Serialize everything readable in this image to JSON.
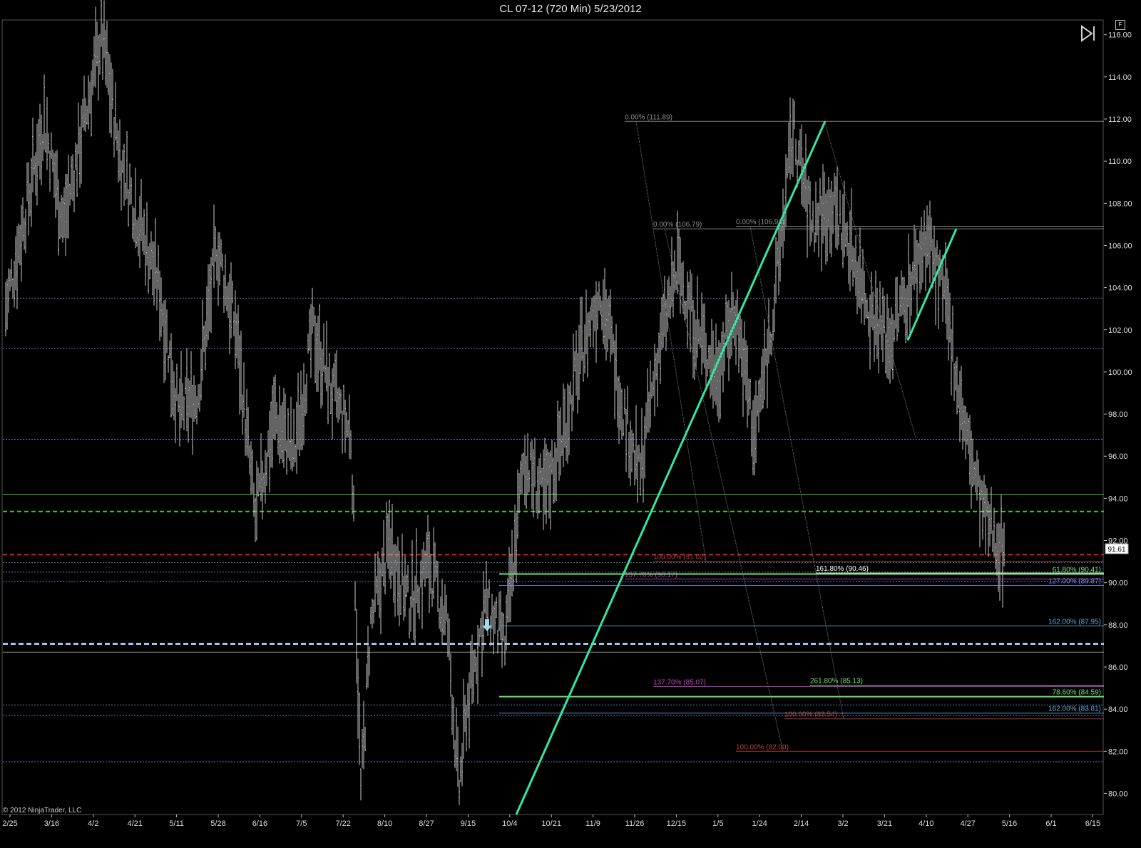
{
  "window": {
    "title": "CL 07-12 (720 Min)  5/23/2012"
  },
  "footer": {
    "copyright": "© 2012 NinjaTrader, LLC"
  },
  "controls": {
    "f_label": "F"
  },
  "colors": {
    "background": "#000000",
    "bars": "#c8c8c8",
    "trendline": "#33e6a0",
    "hline_blue_dash": "#6e86b4",
    "hline_green": "#4fcf4f",
    "hline_red": "#e02020",
    "current_price_box": "#ffffff"
  },
  "chart_data": {
    "type": "ohlc",
    "instrument": "CL 07-12",
    "interval": "720 Min",
    "date": "5/23/2012",
    "ylim": [
      79,
      116.7
    ],
    "y_ticks": [
      "116.00",
      "114.00",
      "112.00",
      "110.00",
      "108.00",
      "106.00",
      "104.00",
      "102.00",
      "100.00",
      "98.00",
      "96.00",
      "94.00",
      "92.00",
      "90.00",
      "88.00",
      "86.00",
      "84.00",
      "82.00",
      "80.00"
    ],
    "x_ticks": [
      "2/25",
      "3/16",
      "4/2",
      "4/21",
      "5/11",
      "5/28",
      "6/16",
      "7/5",
      "7/22",
      "8/10",
      "8/27",
      "9/15",
      "10/4",
      "10/21",
      "11/9",
      "11/26",
      "12/15",
      "1/5",
      "1/24",
      "2/14",
      "3/2",
      "3/21",
      "4/10",
      "4/27",
      "5/16",
      "6/1",
      "6/15"
    ],
    "current_price": "91.61",
    "price_path": [
      [
        0,
        103.0
      ],
      [
        2,
        112.0
      ],
      [
        3,
        107.0
      ],
      [
        5,
        116.0
      ],
      [
        6,
        110.0
      ],
      [
        8,
        104.0
      ],
      [
        9,
        98.0
      ],
      [
        10,
        99.0
      ],
      [
        11,
        106.0
      ],
      [
        12,
        102.0
      ],
      [
        13,
        93.0
      ],
      [
        14,
        98.0
      ],
      [
        15,
        96.0
      ],
      [
        16,
        102.0
      ],
      [
        17,
        99.0
      ],
      [
        18,
        97.0
      ],
      [
        18.5,
        80.0
      ],
      [
        19,
        88.0
      ],
      [
        20,
        92.0
      ],
      [
        21,
        89.0
      ],
      [
        22,
        91.0
      ],
      [
        23,
        88.0
      ],
      [
        23.6,
        80.0
      ],
      [
        24,
        84.0
      ],
      [
        25,
        89.0
      ],
      [
        26,
        87.0
      ],
      [
        27,
        96.0
      ],
      [
        28,
        94.0
      ],
      [
        29,
        97.0
      ],
      [
        30,
        101.0
      ],
      [
        31,
        104.0
      ],
      [
        32,
        99.0
      ],
      [
        33,
        95.0
      ],
      [
        34,
        101.0
      ],
      [
        35,
        105.0
      ],
      [
        36,
        102.0
      ],
      [
        37,
        100.0
      ],
      [
        38,
        103.0
      ],
      [
        39,
        97.0
      ],
      [
        40,
        103.0
      ],
      [
        41,
        111.5
      ],
      [
        42,
        107.0
      ],
      [
        43,
        108.0
      ],
      [
        44,
        106.0
      ],
      [
        45,
        103.0
      ],
      [
        46,
        101.5
      ],
      [
        47,
        104.0
      ],
      [
        48,
        106.5
      ],
      [
        49,
        103.0
      ],
      [
        50,
        97.0
      ],
      [
        51,
        93.0
      ],
      [
        52,
        91.61
      ]
    ],
    "horizontal_lines": [
      {
        "y": 103.5,
        "style": "dotted",
        "color": "blue"
      },
      {
        "y": 101.1,
        "style": "dotted",
        "color": "blue"
      },
      {
        "y": 96.8,
        "style": "dotted",
        "color": "blue"
      },
      {
        "y": 94.2,
        "style": "solid-thin",
        "color": "green"
      },
      {
        "y": 93.38,
        "style": "dashed",
        "color": "green"
      },
      {
        "y": 91.33,
        "style": "dashed",
        "color": "red"
      },
      {
        "y": 90.95,
        "style": "dotted",
        "color": "blue"
      },
      {
        "y": 90.5,
        "style": "dotted",
        "color": "blue"
      },
      {
        "y": 90.05,
        "style": "dotted",
        "color": "blue"
      },
      {
        "y": 87.1,
        "style": "dashed-thick",
        "color": "lightblue"
      },
      {
        "y": 86.7,
        "style": "solid-thin",
        "color": "gray"
      },
      {
        "y": 84.2,
        "style": "dotted",
        "color": "blue"
      },
      {
        "y": 83.7,
        "style": "dotted",
        "color": "blue"
      },
      {
        "y": 81.5,
        "style": "dotted",
        "color": "blue"
      }
    ],
    "trendlines": [
      {
        "from": [
          "10/10",
          79.0
        ],
        "to": [
          "3/2",
          111.89
        ]
      },
      {
        "from": [
          "4/10",
          101.5
        ],
        "to": [
          "5/1",
          106.79
        ]
      }
    ],
    "fib_labels": [
      {
        "text": "0.00% (111.89)",
        "y": 111.89
      },
      {
        "text": "0.00% (106.79)",
        "y": 106.79
      },
      {
        "text": "0.00% (106.91)",
        "y": 106.91
      },
      {
        "text": "100.00% (91.02)",
        "y": 91.02
      },
      {
        "text": "161.80% (90.46)",
        "y": 90.46
      },
      {
        "text": "61.80% (90.41)",
        "y": 90.41
      },
      {
        "text": "137.70% (90.17)",
        "y": 90.17
      },
      {
        "text": "127.00% (89.87)",
        "y": 89.87
      },
      {
        "text": "162.00% (87.95)",
        "y": 87.95
      },
      {
        "text": "137.70% (85.07)",
        "y": 85.07
      },
      {
        "text": "261.80% (85.13)",
        "y": 85.13
      },
      {
        "text": "78.60% (84.59)",
        "y": 84.59
      },
      {
        "text": "162.00% (83.81)",
        "y": 83.81
      },
      {
        "text": "100.00% (83.54)",
        "y": 83.54
      },
      {
        "text": "100.00% (82.00)",
        "y": 82.0
      }
    ]
  }
}
